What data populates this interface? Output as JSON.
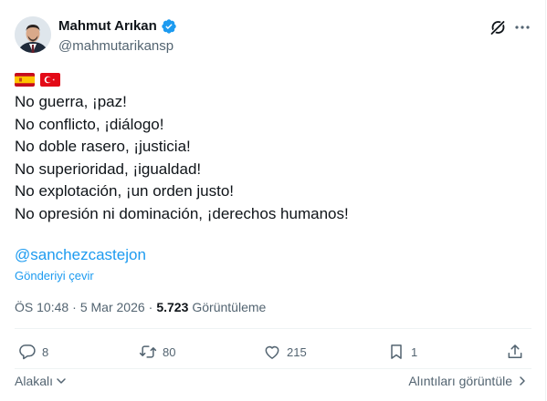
{
  "author": {
    "name": "Mahmut Arıkan",
    "handle": "@mahmutarikansp"
  },
  "tweet": {
    "lines": [
      "No guerra, ¡paz!",
      "No conflicto, ¡diálogo!",
      "No doble rasero, ¡justicia!",
      "No superioridad, ¡igualdad!",
      "No explotación, ¡un orden justo!",
      "No opresión ni dominación, ¡derechos humanos!"
    ],
    "mention": "@sanchezcastejon",
    "translate_label": "Gönderiyi çevir"
  },
  "meta": {
    "time": "ÖS 10:48",
    "separator": "·",
    "date": "5 Mar 2026",
    "views_count": "5.723",
    "views_label": "Görüntüleme"
  },
  "actions": {
    "replies": "8",
    "reposts": "80",
    "likes": "215",
    "bookmarks": "1"
  },
  "footer": {
    "relevant_label": "Alakalı",
    "quotes_label": "Alıntıları görüntüle"
  },
  "colors": {
    "accent": "#1d9bf0",
    "text": "#0f1419",
    "secondary": "#536471",
    "border": "#eff3f4"
  },
  "icons": [
    "grok-icon",
    "more-icon",
    "verified-badge-icon",
    "flag-spain-icon",
    "flag-turkey-icon",
    "reply-icon",
    "repost-icon",
    "like-icon",
    "bookmark-icon",
    "share-icon",
    "chevron-down-icon",
    "chevron-right-icon"
  ]
}
